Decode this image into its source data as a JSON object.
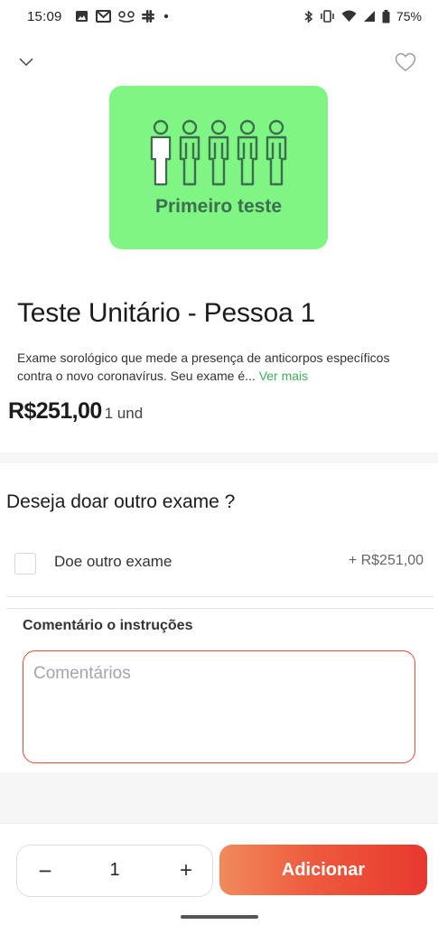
{
  "status_bar": {
    "time": "15:09",
    "battery": "75%",
    "notification_icons": [
      "image-icon",
      "gmail-icon",
      "app-icon",
      "slack-icon",
      "dot-icon"
    ],
    "system_icons": [
      "bluetooth-icon",
      "vibrate-icon",
      "wifi-icon",
      "signal-icon",
      "battery-icon"
    ]
  },
  "header": {
    "back_icon": "chevron-down-icon",
    "favorite_icon": "heart-icon"
  },
  "product": {
    "image_caption": "Primeiro teste",
    "image_bg": "#7ff583",
    "title": "Teste Unitário - Pessoa 1",
    "description": "Exame sorológico que mede a presença de anticorpos específicos contra o novo coronavírus. Seu exame é...",
    "more_link": "Ver mais",
    "price": "R$251,00",
    "unit": "1 und"
  },
  "donate": {
    "title": "Deseja doar outro exame ?",
    "option_label": "Doe outro exame",
    "option_price": "+ R$251,00",
    "checked": false
  },
  "comments": {
    "label": "Comentário o instruções",
    "placeholder": "Comentários"
  },
  "footer": {
    "quantity": "1",
    "minus": "−",
    "plus": "+",
    "add_label": "Adicionar",
    "accent": "#e8382f"
  }
}
